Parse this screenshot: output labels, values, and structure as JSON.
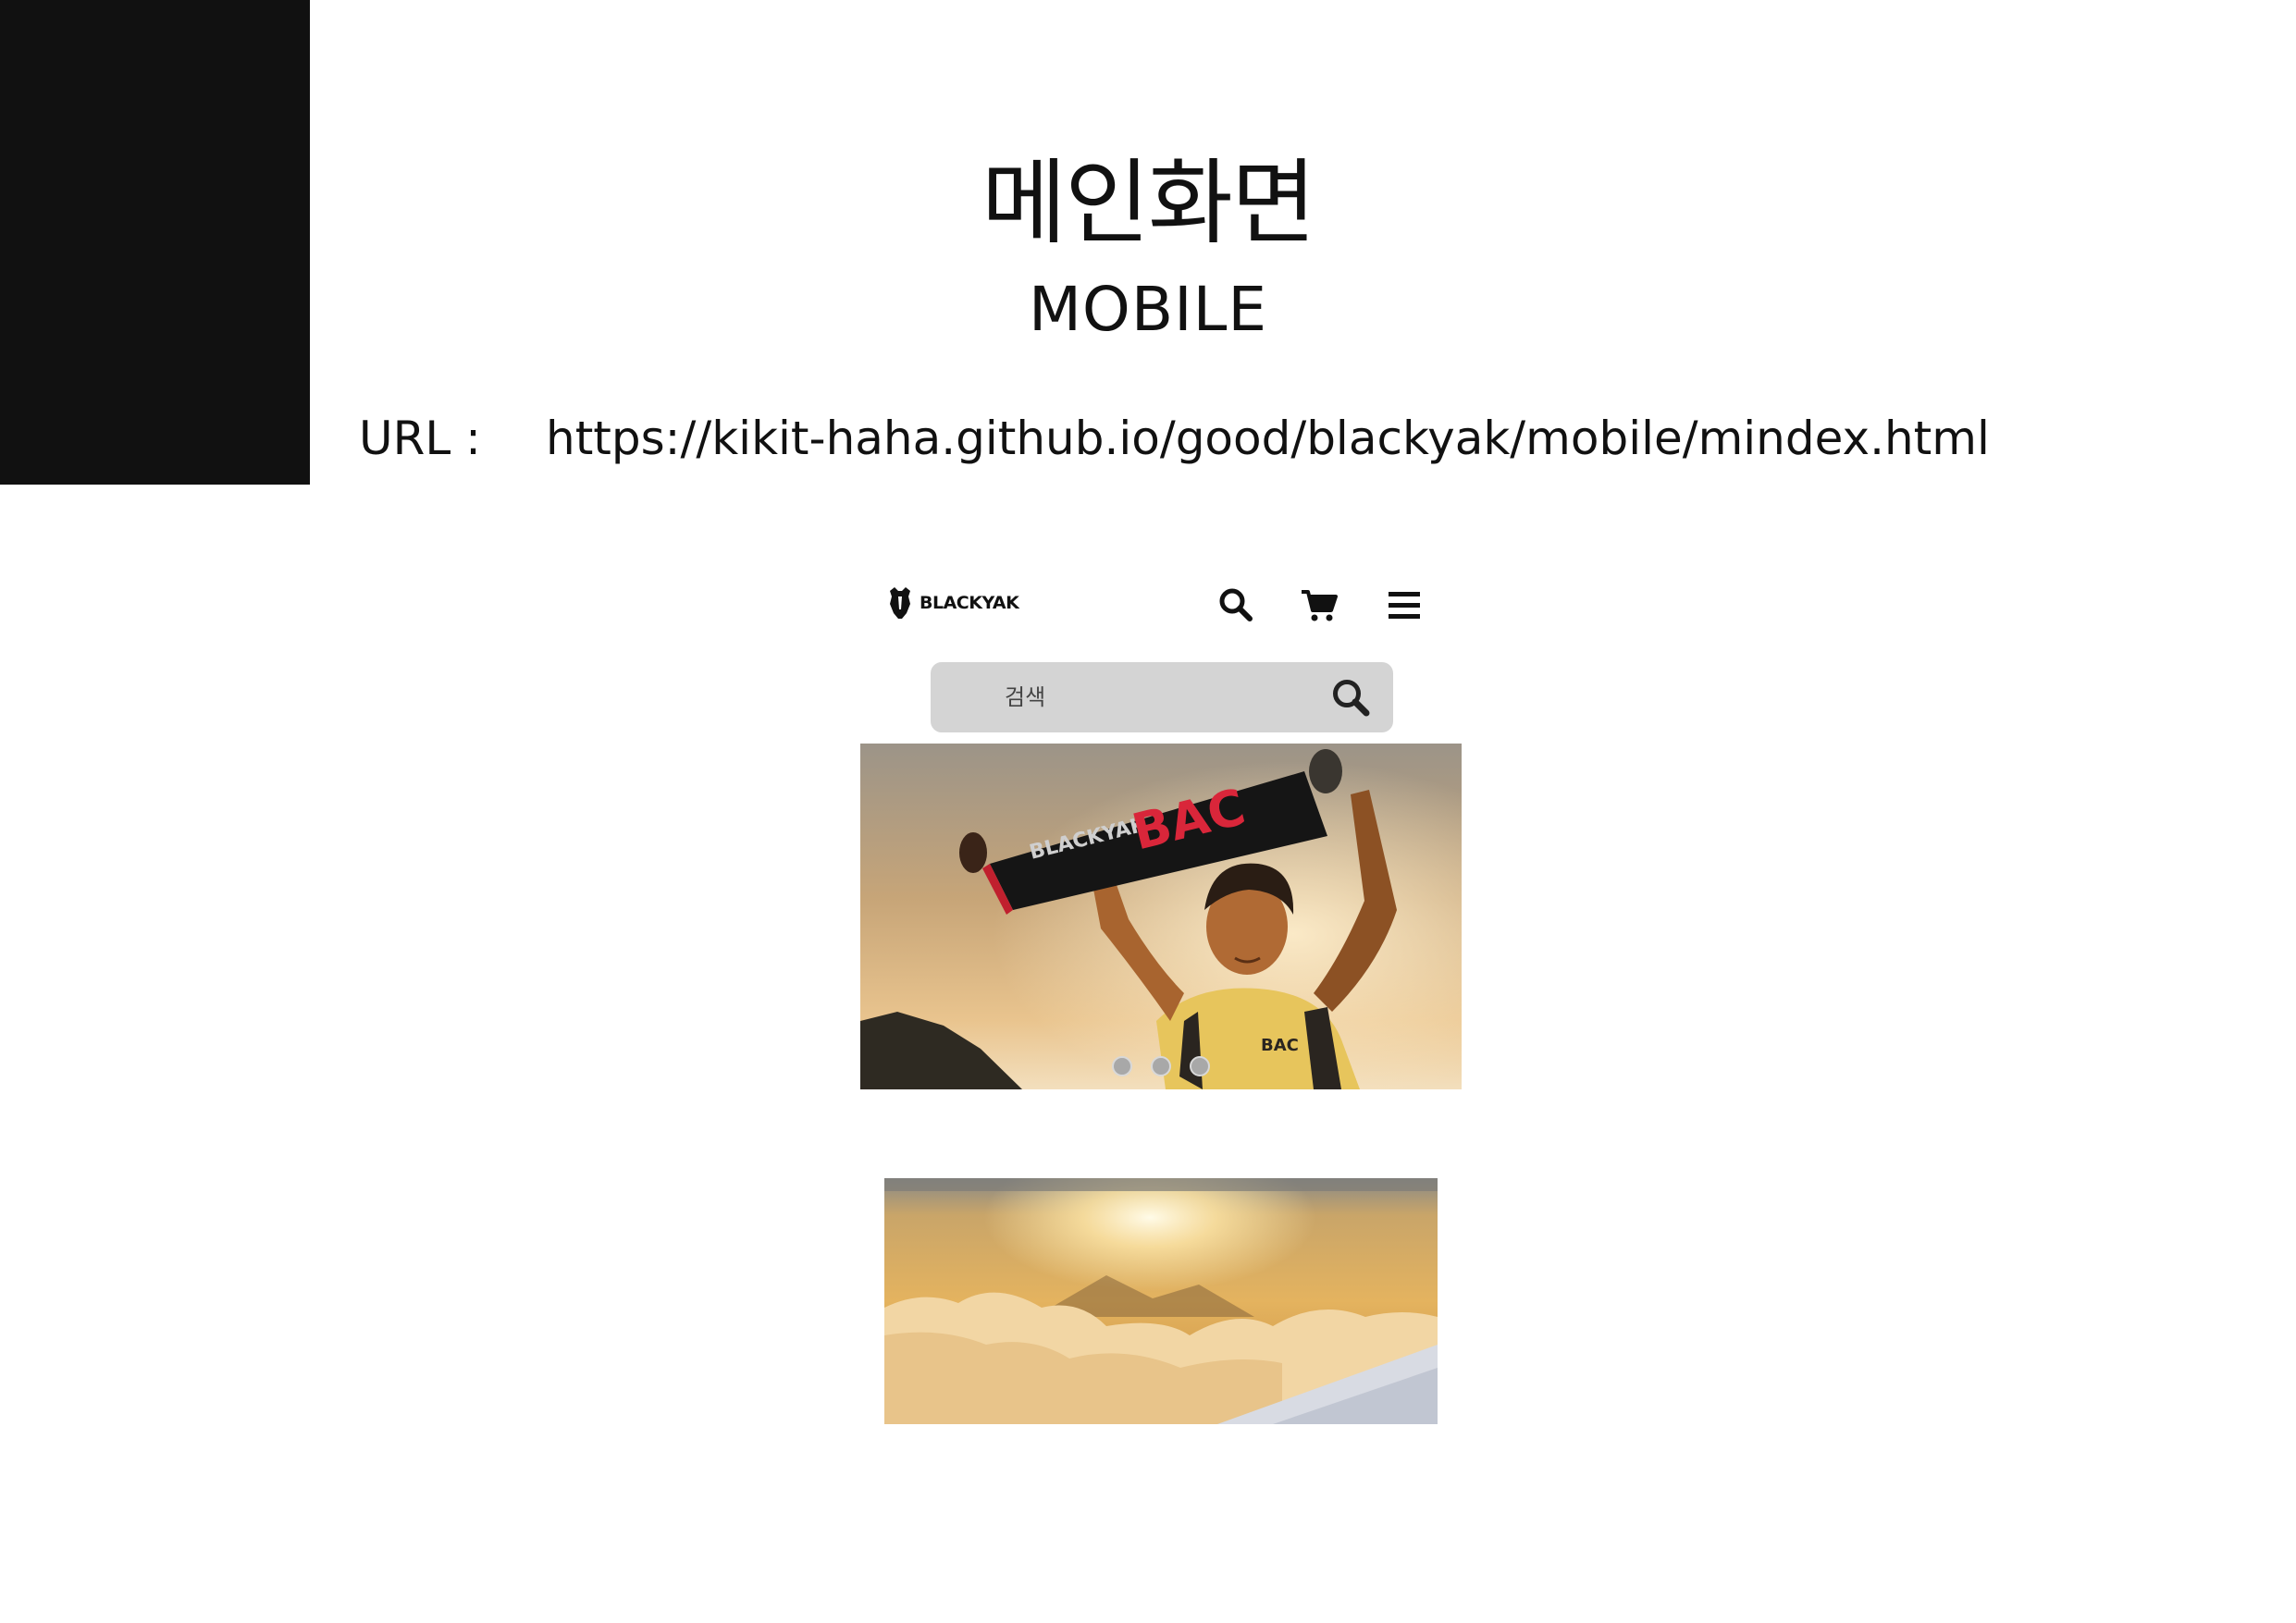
{
  "slide": {
    "title": "메인화면",
    "subtitle": "MOBILE",
    "url_label": "URL :",
    "url_value": "https://kikit-haha.github.io/good/blackyak/mobile/mindex.html"
  },
  "mobile": {
    "header": {
      "logo_text": "BLACKYAK",
      "icons": [
        "search-icon",
        "cart-icon",
        "menu-icon"
      ]
    },
    "search": {
      "placeholder": "검색",
      "value": ""
    },
    "hero": {
      "slide_count": 3,
      "banner_brand": "BLACKYAK",
      "banner_text": "BAC",
      "shirt_text": "BAC"
    }
  },
  "colors": {
    "black_block": "#111111",
    "search_bg": "#d4d4d4",
    "hero_banner_red": "#d9263a",
    "dot": "#a8a8a8"
  }
}
